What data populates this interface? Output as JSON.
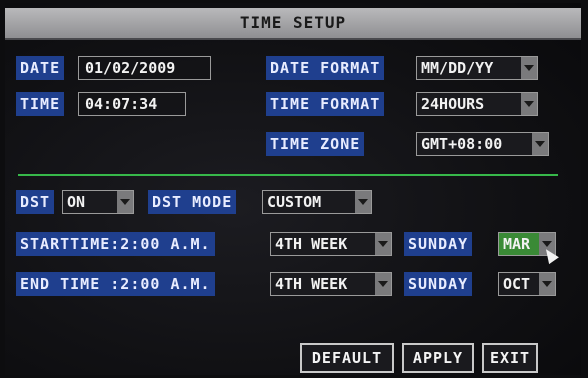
{
  "window": {
    "title": "TIME SETUP"
  },
  "date": {
    "label": "DATE",
    "value": "01/02/2009"
  },
  "time": {
    "label": "TIME",
    "value": "04:07:34"
  },
  "date_format": {
    "label": "DATE FORMAT",
    "value": "MM/DD/YY"
  },
  "time_format": {
    "label": "TIME FORMAT",
    "value": "24HOURS"
  },
  "time_zone": {
    "label": "TIME  ZONE",
    "value": "GMT+08:00"
  },
  "dst": {
    "label": "DST",
    "value": "ON"
  },
  "dst_mode": {
    "label": "DST MODE",
    "value": "CUSTOM"
  },
  "start": {
    "label": "STARTTIME:2:00 A.M.",
    "week": "4TH WEEK",
    "day": "SUNDAY",
    "month": "MAR"
  },
  "end": {
    "label": "END TIME :2:00 A.M.",
    "week": "4TH WEEK",
    "day": "SUNDAY",
    "month": "OCT"
  },
  "buttons": {
    "default": "DEFAULT",
    "apply": "APPLY",
    "exit": "EXIT"
  },
  "colors": {
    "label_bg": "#1f3f8e",
    "highlight": "#3a8a36",
    "divider": "#37b84a"
  }
}
